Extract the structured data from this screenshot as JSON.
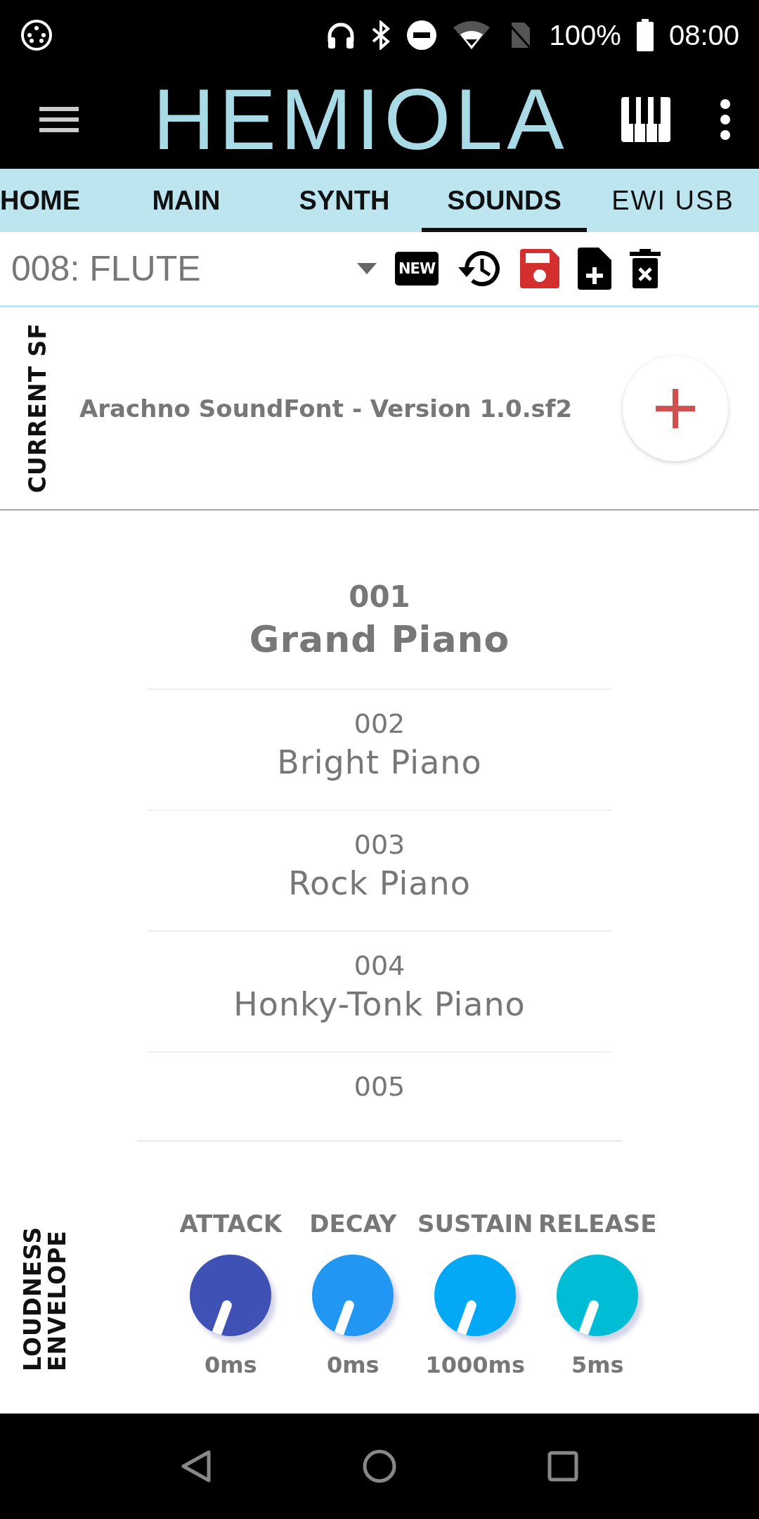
{
  "status_bar": {
    "battery": "100%",
    "time": "08:00"
  },
  "header": {
    "logo": "HEMIOLA"
  },
  "tabs": [
    {
      "label": "HOME",
      "selected": false
    },
    {
      "label": "MAIN",
      "selected": false
    },
    {
      "label": "SYNTH",
      "selected": false
    },
    {
      "label": "SOUNDS",
      "selected": true
    },
    {
      "label": "EWI USB",
      "selected": false
    }
  ],
  "toolbar": {
    "preset": "008: FLUTE",
    "new_badge": "NEW"
  },
  "current_sf": {
    "label": "CURRENT SF",
    "file": "Arachno SoundFont - Version 1.0.sf2"
  },
  "presets": [
    {
      "number": "001",
      "name": "Grand Piano",
      "selected": true
    },
    {
      "number": "002",
      "name": "Bright Piano",
      "selected": false
    },
    {
      "number": "003",
      "name": "Rock Piano",
      "selected": false
    },
    {
      "number": "004",
      "name": "Honky-Tonk Piano",
      "selected": false
    },
    {
      "number": "005",
      "selected": false
    }
  ],
  "envelope": {
    "label": "LOUDNESS ENVELOPE",
    "knobs": [
      {
        "label": "ATTACK",
        "value": "0ms",
        "color": "#3f51b5"
      },
      {
        "label": "DECAY",
        "value": "0ms",
        "color": "#2196f3"
      },
      {
        "label": "SUSTAIN",
        "value": "1000ms",
        "color": "#03a9f4"
      },
      {
        "label": "RELEASE",
        "value": "5ms",
        "color": "#00bcd4"
      }
    ]
  }
}
